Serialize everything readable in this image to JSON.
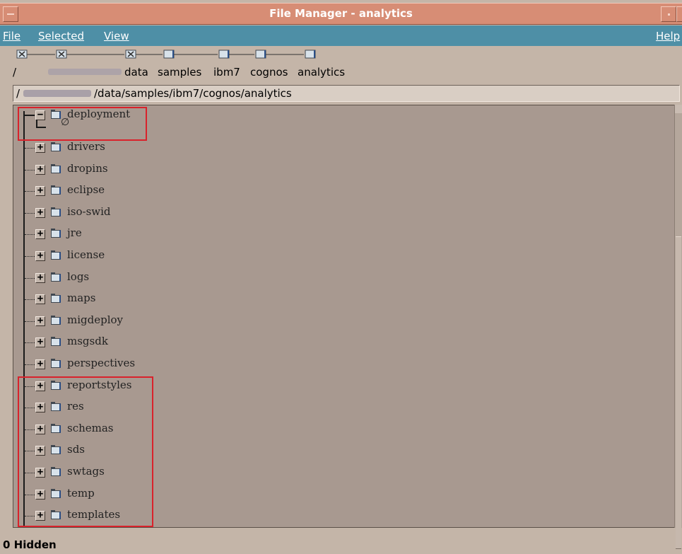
{
  "window": {
    "title": "File Manager - analytics"
  },
  "menu": {
    "file": "File",
    "selected": "Selected",
    "view": "View",
    "help": "Help"
  },
  "path_icon_names": [
    "folder-link-icon",
    "folder-link-icon",
    "folder-link-icon",
    "folder-icon",
    "folder-icon",
    "folder-icon",
    "folder-icon"
  ],
  "breadcrumbs": {
    "root": "/",
    "items": [
      "data",
      "samples",
      "ibm7",
      "cognos",
      "analytics"
    ]
  },
  "path_field": {
    "value": "/data/samples/ibm7/cognos/analytics"
  },
  "tree": {
    "expanded": {
      "label": "deployment",
      "expander": "−",
      "empty_symbol": "∅"
    },
    "items": [
      "drivers",
      "dropins",
      "eclipse",
      "iso-swid",
      "jre",
      "license",
      "logs",
      "maps",
      "migdeploy",
      "msgsdk",
      "perspectives",
      "reportstyles",
      "res",
      "schemas",
      "sds",
      "swtags",
      "temp",
      "templates"
    ],
    "expander": "+"
  },
  "status": {
    "text": "0 Hidden"
  }
}
